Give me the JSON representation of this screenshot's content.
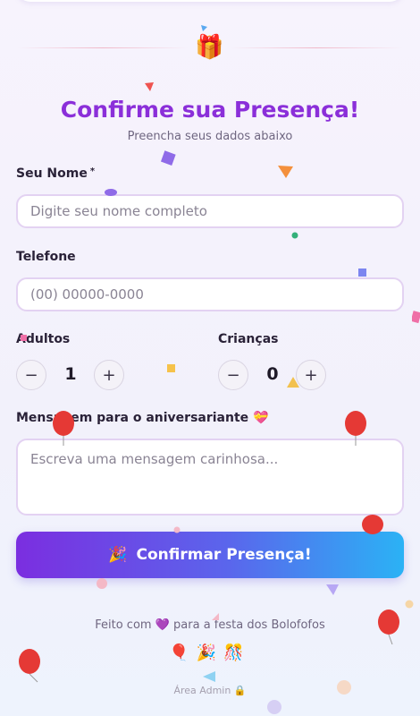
{
  "header": {
    "gift_emoji": "🎁",
    "title": "Confirme sua Presença!",
    "subtitle": "Preencha seus dados abaixo"
  },
  "form": {
    "name": {
      "label": "Seu Nome",
      "required_mark": "*",
      "placeholder": "Digite seu nome completo"
    },
    "phone": {
      "label": "Telefone",
      "placeholder": "(00) 00000-0000"
    },
    "adults": {
      "label": "Adultos",
      "value": "1",
      "minus": "−",
      "plus": "+"
    },
    "children": {
      "label": "Crianças",
      "value": "0",
      "minus": "−",
      "plus": "+"
    },
    "message": {
      "label": "Mensagem para o aniversariante",
      "label_emoji": "💝",
      "placeholder": "Escreva uma mensagem carinhosa..."
    },
    "submit": {
      "icon": "🎉",
      "label": "Confirmar Presença!"
    }
  },
  "footer": {
    "made_with_prefix": "Feito com",
    "heart": "💜",
    "made_with_suffix": "para a festa dos Bolofofos",
    "emojis": "🎈🎉🎊",
    "admin_link": "Área Admin 🔒"
  },
  "colors": {
    "title": "#8b2fd9",
    "button_start": "#7b2ee0",
    "button_end": "#2bb2f5",
    "input_border": "#e3d2f2"
  }
}
